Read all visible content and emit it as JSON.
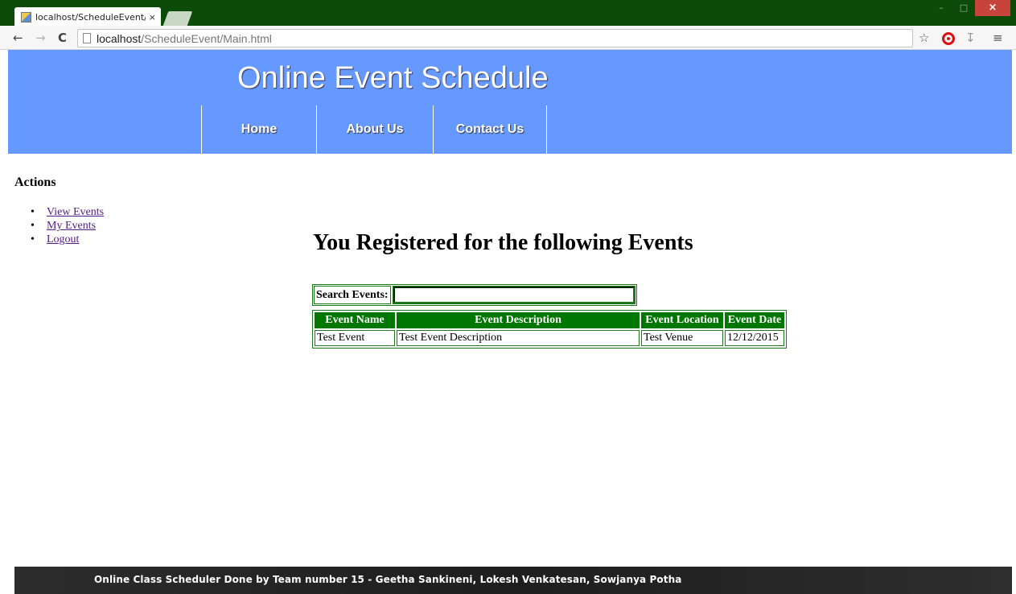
{
  "browser": {
    "tab_title": "localhost/ScheduleEvent/",
    "tab_close": "×",
    "url_host": "localhost",
    "url_path": "/ScheduleEvent/Main.html",
    "window_min": "–",
    "window_max": "□",
    "window_close": "×"
  },
  "header": {
    "title": "Online Event Schedule",
    "nav": [
      "Home",
      "About Us",
      "Contact Us"
    ]
  },
  "sidebar": {
    "heading": "Actions",
    "items": [
      "View Events",
      "My Events",
      "Logout"
    ]
  },
  "main": {
    "heading": "You Registered for the following Events",
    "search_label": "Search Events:",
    "search_value": "",
    "table": {
      "columns": [
        "Event Name",
        "Event Description",
        "Event Location",
        "Event Date"
      ],
      "rows": [
        [
          "Test Event",
          "Test Event Description",
          "Test Venue",
          "12/12/2015"
        ]
      ]
    }
  },
  "footer": {
    "text": "Online Class Scheduler Done by Team number 15 - Geetha Sankineni, Lokesh Venkatesan, Sowjanya Potha"
  },
  "colors": {
    "header_bg": "#6699ff",
    "table_header_bg": "#007700",
    "browser_frame": "#0d4b0a",
    "footer_bg": "#242424"
  }
}
